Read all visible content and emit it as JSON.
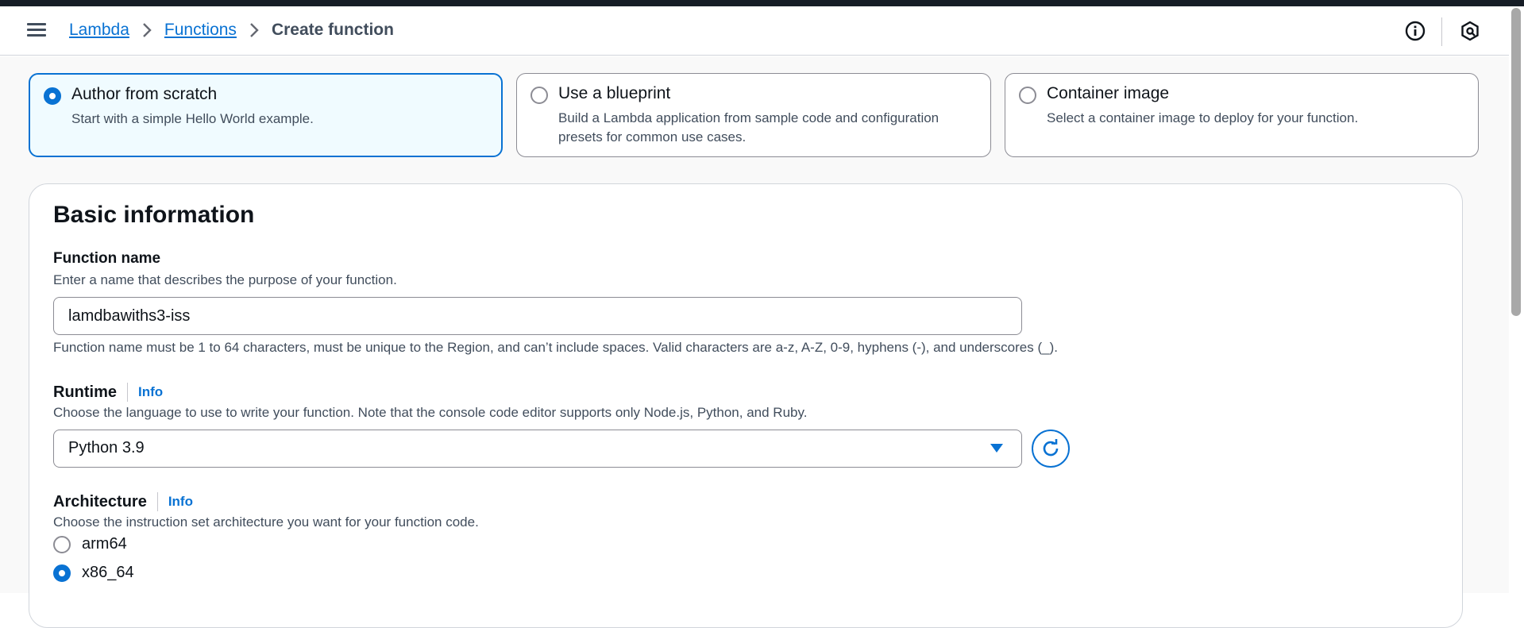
{
  "header": {
    "breadcrumbs": [
      "Lambda",
      "Functions",
      "Create function"
    ],
    "icons": [
      "menu-icon",
      "info-icon",
      "notifications-icon"
    ]
  },
  "options": [
    {
      "title": "Author from scratch",
      "description": "Start with a simple Hello World example.",
      "selected": true
    },
    {
      "title": "Use a blueprint",
      "description": "Build a Lambda application from sample code and configuration presets for common use cases.",
      "selected": false
    },
    {
      "title": "Container image",
      "description": "Select a container image to deploy for your function.",
      "selected": false
    }
  ],
  "basic_info": {
    "title": "Basic information",
    "function_name": {
      "label": "Function name",
      "description": "Enter a name that describes the purpose of your function.",
      "value": "lamdbawiths3-iss",
      "constraint": "Function name must be 1 to 64 characters, must be unique to the Region, and can’t include spaces. Valid characters are a-z, A-Z, 0-9, hyphens (-), and underscores (_)."
    },
    "runtime": {
      "label": "Runtime",
      "info": "Info",
      "description": "Choose the language to use to write your function. Note that the console code editor supports only Node.js, Python, and Ruby.",
      "value": "Python 3.9"
    },
    "architecture": {
      "label": "Architecture",
      "info": "Info",
      "description": "Choose the instruction set architecture you want for your function code.",
      "options": [
        {
          "label": "arm64",
          "selected": false
        },
        {
          "label": "x86_64",
          "selected": true
        }
      ]
    }
  },
  "colors": {
    "accent": "#0972d3",
    "header_strip": "#161d26"
  }
}
